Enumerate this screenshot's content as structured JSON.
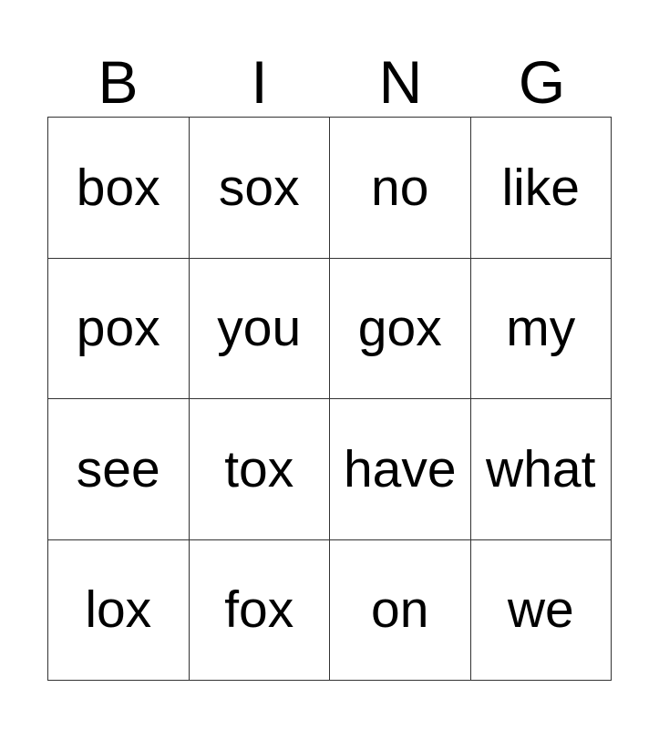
{
  "header": [
    "B",
    "I",
    "N",
    "G"
  ],
  "cells": [
    [
      "box",
      "sox",
      "no",
      "like"
    ],
    [
      "pox",
      "you",
      "gox",
      "my"
    ],
    [
      "see",
      "tox",
      "have",
      "what"
    ],
    [
      "lox",
      "fox",
      "on",
      "we"
    ]
  ]
}
